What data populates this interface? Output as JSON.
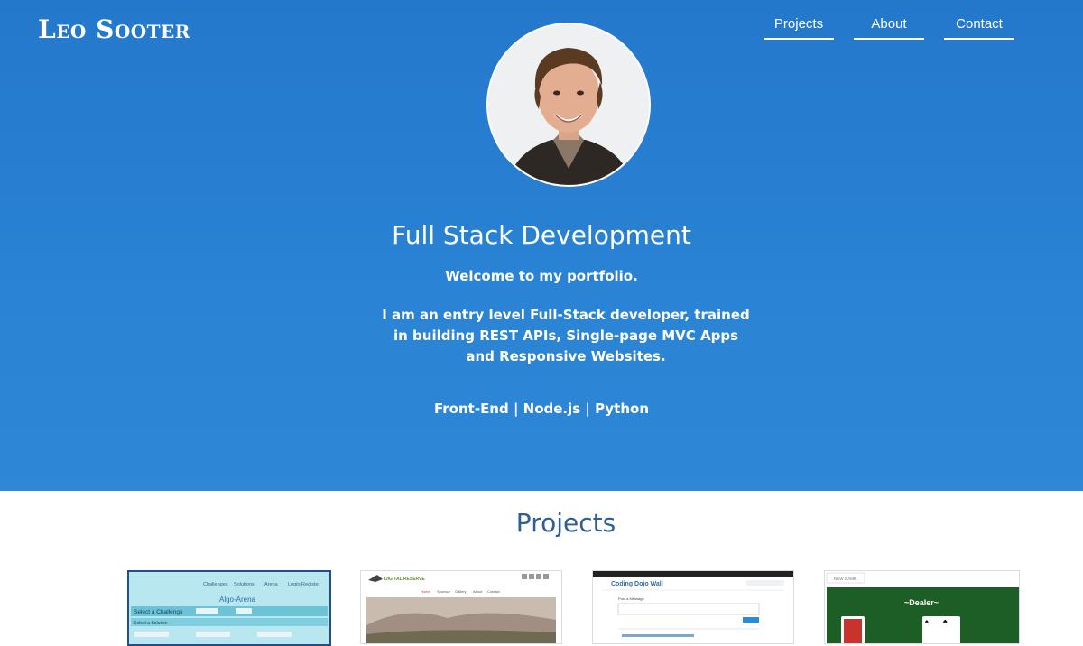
{
  "header": {
    "brand": "Leo Sooter",
    "nav": [
      {
        "label": "Projects"
      },
      {
        "label": "About"
      },
      {
        "label": "Contact"
      }
    ]
  },
  "hero": {
    "title": "Full Stack Development",
    "welcome": "Welcome to my portfolio.",
    "intro": "I am an entry level Full-Stack developer, trained in building REST APIs, Single-page MVC Apps and Responsive Websites.",
    "skills": "Front-End | Node.js | Python"
  },
  "projects": {
    "title": "Projects",
    "cards": [
      {
        "name": "Algo-Arena",
        "nav": [
          "Challenges",
          "Solutions",
          "Arena",
          "Login/Register"
        ],
        "heading": "Algo-Arena",
        "row1": "Select a Challenge",
        "row2": "Select a Solution"
      },
      {
        "name": "Digital Reserve",
        "logo": "DIGITAL RESERVE",
        "nav": [
          "Home",
          "Sponsor",
          "Gallery",
          "About",
          "Contact"
        ]
      },
      {
        "name": "Coding Dojo Wall",
        "heading": "Coding Dojo Wall",
        "sub": "Post a Message"
      },
      {
        "name": "Dealer",
        "tab": "NEW GAME",
        "heading": "~Dealer~"
      }
    ]
  },
  "colors": {
    "hero_bg": "#2478cc",
    "projects_title": "#2d5f97",
    "white": "#ffffff"
  }
}
